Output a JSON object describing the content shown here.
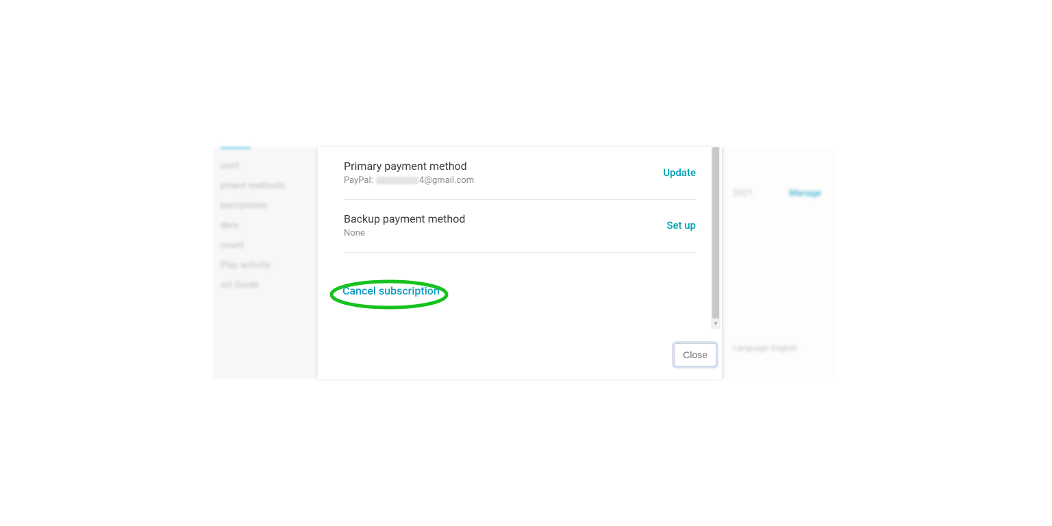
{
  "sidebar": {
    "items": [
      {
        "label": ""
      },
      {
        "label": "ount"
      },
      {
        "label": "yment methods"
      },
      {
        "label": "bscriptions"
      },
      {
        "label": "ders"
      },
      {
        "label": "count"
      },
      {
        "label": "Play activity"
      },
      {
        "label": "ort Guide"
      }
    ]
  },
  "background": {
    "date_fragment": "2021",
    "manage_label": "Manage",
    "language_line": "Language  English"
  },
  "dialog": {
    "primary": {
      "title": "Primary payment method",
      "provider_prefix": "PayPal:",
      "email_suffix": "4@gmail.com",
      "action": "Update"
    },
    "backup": {
      "title": "Backup payment method",
      "value": "None",
      "action": "Set up"
    },
    "cancel_label": "Cancel subscription",
    "close_label": "Close"
  },
  "colors": {
    "link_teal": "#009fb2",
    "link_blue": "#0f9bc4",
    "highlight_green": "#17c21f"
  }
}
